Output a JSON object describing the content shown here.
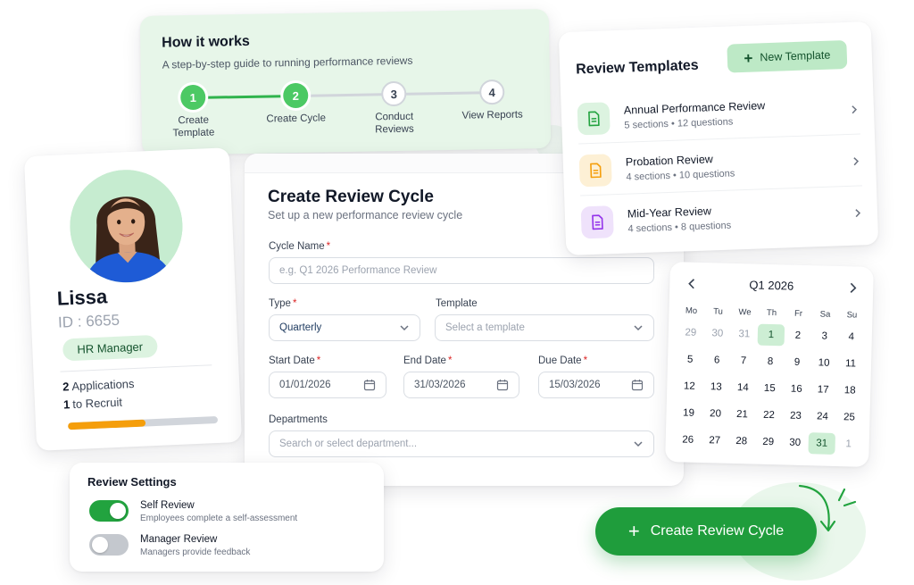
{
  "how_it_works": {
    "title": "How it works",
    "subtitle": "A step-by-step guide to running performance reviews",
    "steps": [
      {
        "number": "1",
        "label": "Create Template",
        "state": "done"
      },
      {
        "number": "2",
        "label": "Create Cycle",
        "state": "done"
      },
      {
        "number": "3",
        "label": "Conduct Reviews",
        "state": "pending"
      },
      {
        "number": "4",
        "label": "View Reports",
        "state": "pending"
      }
    ]
  },
  "profile": {
    "name": "Lissa",
    "id": "ID : 6655",
    "role": "HR Manager",
    "applications_count": "2",
    "applications_label": "Applications",
    "recruit_count": "1",
    "recruit_label": "to Recruit",
    "progress": 0.52,
    "progress_color": "#f59e0b"
  },
  "form": {
    "title": "Create Review Cycle",
    "subtitle": "Set up a new performance review cycle",
    "required_mark": "*",
    "cycle_name_label": "Cycle Name",
    "cycle_name_placeholder": "e.g. Q1 2026 Performance Review",
    "type_label": "Type",
    "type_value": "Quarterly",
    "template_label": "Template",
    "template_placeholder": "Select a template",
    "start_date_label": "Start Date",
    "start_date_value": "01/01/2026",
    "end_date_label": "End Date",
    "end_date_value": "31/03/2026",
    "due_date_label": "Due Date",
    "due_date_value": "15/03/2026",
    "departments_label": "Departments",
    "departments_placeholder": "Search or select department..."
  },
  "templates": {
    "title": "Review Templates",
    "new_label": "New Template",
    "items": [
      {
        "name": "Annual Performance Review",
        "meta": "5 sections • 12 questions",
        "icon": "document-icon",
        "color": "#22a33f",
        "bg": "#dcf3e0"
      },
      {
        "name": "Probation Review",
        "meta": "4 sections • 10 questions",
        "icon": "document-icon",
        "color": "#f59e0b",
        "bg": "#fdf0d5"
      },
      {
        "name": "Mid-Year Review",
        "meta": "4 sections • 8 questions",
        "icon": "document-icon",
        "color": "#9333ea",
        "bg": "#efe2fb"
      }
    ]
  },
  "calendar": {
    "title": "Q1 2026",
    "weekdays": [
      "Mo",
      "Tu",
      "We",
      "Th",
      "Fr",
      "Sa",
      "Su"
    ],
    "weeks": [
      [
        "29",
        "30",
        "31",
        "1",
        "2",
        "3",
        "4"
      ],
      [
        "5",
        "6",
        "7",
        "8",
        "9",
        "10",
        "11"
      ],
      [
        "12",
        "13",
        "14",
        "15",
        "16",
        "17",
        "18"
      ],
      [
        "19",
        "20",
        "21",
        "22",
        "23",
        "24",
        "25"
      ],
      [
        "26",
        "27",
        "28",
        "29",
        "30",
        "31",
        "1"
      ]
    ]
  },
  "settings": {
    "title": "Review Settings",
    "items": [
      {
        "label": "Self Review",
        "desc": "Employees complete a self-assessment",
        "enabled": true
      },
      {
        "label": "Manager Review",
        "desc": "Managers provide feedback",
        "enabled": false
      }
    ]
  },
  "cta": {
    "label": "Create Review Cycle",
    "color": "#1f9d3c"
  },
  "colors": {
    "accent": "#22a33f",
    "accent_light": "#4cc964",
    "step_pending": "#d1d5db"
  }
}
